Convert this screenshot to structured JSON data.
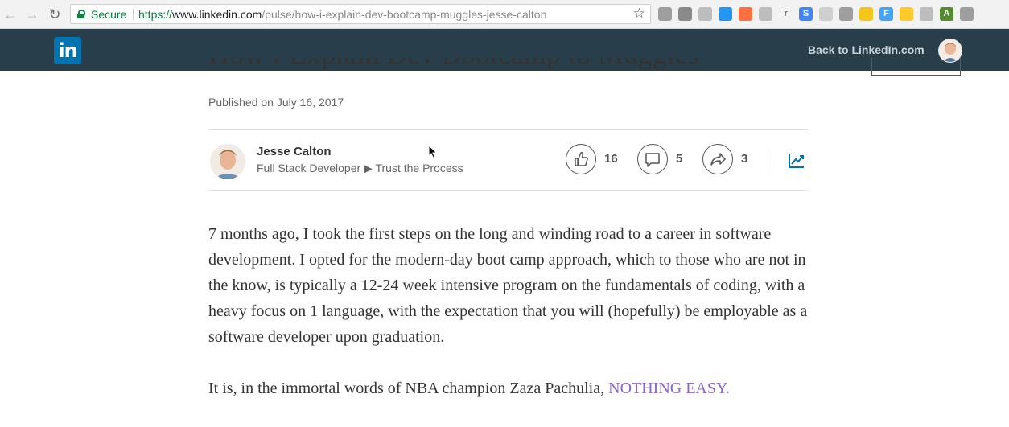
{
  "browser": {
    "secure_label": "Secure",
    "url_protocol": "https://",
    "url_domain": "www.linkedin.com",
    "url_path": "/pulse/how-i-explain-dev-bootcamp-muggles-jesse-calton",
    "extensions": [
      {
        "name": "ext-1-icon",
        "color": "#9e9e9e",
        "glyph": ""
      },
      {
        "name": "ext-2-icon",
        "color": "#8a8a8a",
        "glyph": ""
      },
      {
        "name": "ext-3-icon",
        "color": "#bdbdbd",
        "glyph": ""
      },
      {
        "name": "ext-4-icon",
        "color": "#2196f3",
        "glyph": ""
      },
      {
        "name": "ext-5-icon",
        "color": "#ff6e40",
        "glyph": ""
      },
      {
        "name": "ext-6-icon",
        "color": "#bdbdbd",
        "glyph": ""
      },
      {
        "name": "ext-7-icon",
        "color": "#f2f2f2",
        "glyph": "r"
      },
      {
        "name": "ext-8-icon",
        "color": "#4285f4",
        "glyph": "S"
      },
      {
        "name": "ext-9-icon",
        "color": "#cfcfcf",
        "glyph": ""
      },
      {
        "name": "ext-10-icon",
        "color": "#9e9e9e",
        "glyph": ""
      },
      {
        "name": "ext-11-icon",
        "color": "#f5c518",
        "glyph": ""
      },
      {
        "name": "ext-12-icon",
        "color": "#42a5f5",
        "glyph": "F"
      },
      {
        "name": "ext-13-icon",
        "color": "#ffca28",
        "glyph": ""
      },
      {
        "name": "ext-14-icon",
        "color": "#bdbdbd",
        "glyph": ""
      },
      {
        "name": "ext-15-icon",
        "color": "#558b2f",
        "glyph": "A"
      },
      {
        "name": "ext-16-icon",
        "color": "#9e9e9e",
        "glyph": ""
      }
    ]
  },
  "header": {
    "logo_text": "in",
    "back_link": "Back to LinkedIn.com",
    "brand_color": "#0073b1",
    "bar_color": "#283e4a"
  },
  "article": {
    "title_fragment": "How I Explain Dev Bootcamp to Muggles",
    "published": "Published on July 16, 2017",
    "author": {
      "name": "Jesse Calton",
      "title_left": "Full Stack Developer",
      "title_sep": "▶",
      "title_right": "Trust the Process"
    },
    "actions": {
      "likes": "16",
      "comments": "5",
      "shares": "3"
    },
    "paragraph_1": "7 months ago, I took the first steps on the long and winding road to a career in software development. I opted for the modern-day boot camp approach, which to those who are not in the know, is typically a 12-24 week intensive program on the fundamentals of coding, with a heavy focus on 1 language, with the expectation that you will (hopefully) be employable as a software developer upon graduation.",
    "paragraph_2_prefix": "It is, in the immortal words of NBA champion Zaza Pachulia, ",
    "paragraph_2_highlight": "NOTHING EASY."
  }
}
